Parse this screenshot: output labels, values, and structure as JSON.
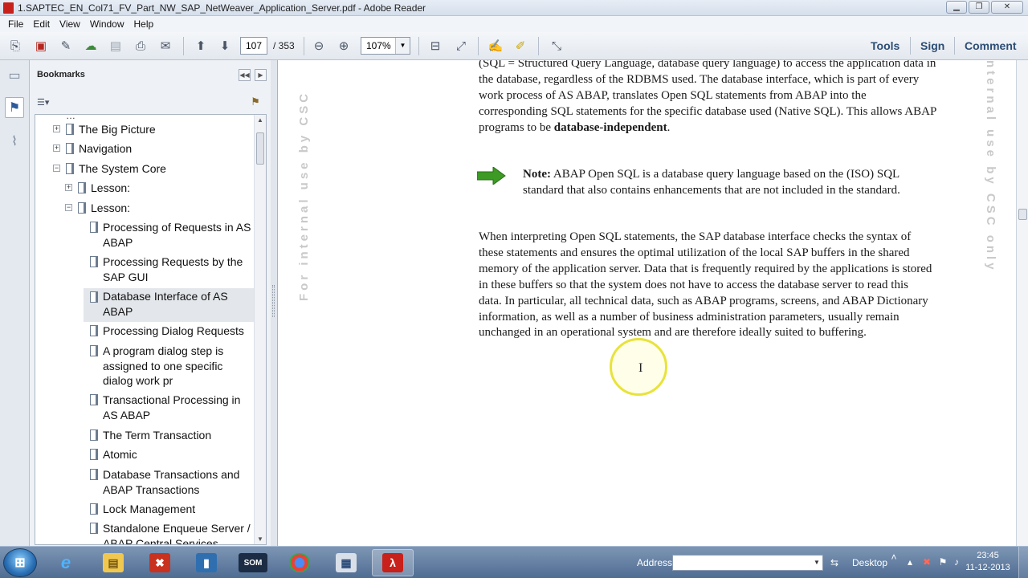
{
  "window": {
    "title": "1.SAPTEC_EN_Col71_FV_Part_NW_SAP_NetWeaver_Application_Server.pdf - Adobe Reader",
    "minimize": "▁",
    "maximize": "❐",
    "close": "✕"
  },
  "menu": [
    "File",
    "Edit",
    "View",
    "Window",
    "Help"
  ],
  "toolbar": {
    "page_current": "107",
    "page_total": "/ 353",
    "zoom": "107%",
    "zoom_dropdown": "▼",
    "tools": "Tools",
    "sign": "Sign",
    "comment": "Comment"
  },
  "bookmarks": {
    "title": "Bookmarks",
    "collapse": "◀◀",
    "expand": "▶",
    "options_glyph": "☰▾",
    "items": [
      {
        "label": "The Big Picture",
        "toggle": "+"
      },
      {
        "label": "Navigation",
        "toggle": "+"
      },
      {
        "label": "The System Core",
        "toggle": "−"
      },
      {
        "label": "Lesson:",
        "toggle": "+"
      },
      {
        "label": "Lesson:",
        "toggle": "−"
      },
      {
        "label": "Processing of Requests in AS ABAP"
      },
      {
        "label": "Processing Requests by the SAP GUI"
      },
      {
        "label": "Database Interface of AS ABAP"
      },
      {
        "label": "Processing Dialog Requests"
      },
      {
        "label": "A program dialog step is assigned to one specific dialog work pr"
      },
      {
        "label": "Transactional Processing in AS ABAP"
      },
      {
        "label": "The Term Transaction"
      },
      {
        "label": "Atomic"
      },
      {
        "label": "Database Transactions and ABAP Transactions"
      },
      {
        "label": "Lock Management"
      },
      {
        "label": "Standalone Enqueue Server / ABAP Central Services"
      }
    ]
  },
  "document": {
    "watermark_left": "For internal use by CSC",
    "watermark_right": "nternal use by CSC only",
    "p1_text": "(SQL = Structured Query Language, database query language) to access the application data in the database, regardless of the RDBMS used. The database interface, which is part of every work process of AS ABAP, translates Open SQL statements from ABAP into the corresponding SQL statements for the specific database used (Native SQL). This allows ABAP programs to be ",
    "p1_bold": "database-independent",
    "p1_end": ".",
    "note_label": "Note:",
    "note_text": " ABAP Open SQL is a database query language based on the (ISO) SQL standard that also contains enhancements that are not included in the standard.",
    "p2_text": "When interpreting Open SQL statements, the SAP database interface checks the syntax of these statements and ensures the optimal utilization of the local SAP buffers in the shared memory of the application server. Data that is frequently required by the applications is stored in these buffers so that the system does not have to access the database server to read this data. In particular, all technical data, such as ABAP programs, screens, and ABAP Dictionary information, as well as a number of business administration parameters, usually remain unchanged in an operational system and are therefore ideally suited to buffering.",
    "cursor": "I"
  },
  "taskbar": {
    "address_label": "Address",
    "desktop_label": "Desktop",
    "time": "23:45",
    "date": "11-12-2013",
    "address_dropdown": "▼",
    "address_go": "⇆",
    "apps": [
      {
        "name": "internet-explorer",
        "glyph": "e"
      },
      {
        "name": "file-explorer",
        "glyph": "▤"
      },
      {
        "name": "app-red",
        "glyph": "✖"
      },
      {
        "name": "app-notepad",
        "glyph": "▮"
      },
      {
        "name": "app-som",
        "glyph": "SOM"
      },
      {
        "name": "chrome",
        "glyph": "◉"
      },
      {
        "name": "app-network",
        "glyph": "▦"
      },
      {
        "name": "adobe-reader",
        "glyph": "λ"
      }
    ]
  },
  "colors": {
    "accent": "#2c4d74",
    "note_arrow": "#3c9a25",
    "cursor_halo": "#e8e33a"
  }
}
